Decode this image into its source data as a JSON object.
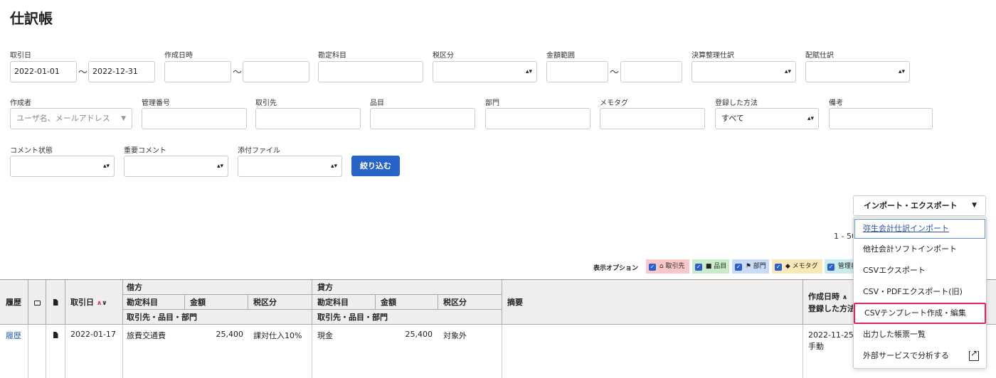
{
  "page": {
    "title": "仕訳帳"
  },
  "filters": {
    "trade_date": {
      "label": "取引日",
      "from": "2022-01-01",
      "to": "2022-12-31",
      "separator": "〜"
    },
    "created_at": {
      "label": "作成日時",
      "separator": "〜"
    },
    "account": {
      "label": "勘定科目"
    },
    "tax": {
      "label": "税区分"
    },
    "amount": {
      "label": "金額範囲",
      "separator": "〜"
    },
    "closing": {
      "label": "決算整理仕訳"
    },
    "allocation": {
      "label": "配賦仕訳"
    },
    "creator": {
      "label": "作成者",
      "placeholder": "ユーザ名、メールアドレス"
    },
    "manage_no": {
      "label": "管理番号"
    },
    "partner": {
      "label": "取引先"
    },
    "item": {
      "label": "品目"
    },
    "dept": {
      "label": "部門"
    },
    "memo_tag": {
      "label": "メモタグ"
    },
    "reg_method": {
      "label": "登録した方法",
      "value": "すべて"
    },
    "note": {
      "label": "備考"
    },
    "comment_status": {
      "label": "コメント状態"
    },
    "important_comment": {
      "label": "重要コメント"
    },
    "attachment": {
      "label": "添付ファイル"
    },
    "submit": "絞り込む"
  },
  "toolbar": {
    "import_export": "インポート・エクスポート",
    "range": "1 - 50",
    "display_options_label": "表示オプション",
    "chips": [
      {
        "label": "取引先",
        "color": "#f8c8c8"
      },
      {
        "label": "品目",
        "color": "#c8ecc8"
      },
      {
        "label": "部門",
        "color": "#c8dcf8"
      },
      {
        "label": "メモタグ",
        "color": "#f8e8b8"
      },
      {
        "label": "管理番号",
        "color": "#c8ecec"
      }
    ]
  },
  "menu": {
    "items": [
      "弥生会計仕訳インポート",
      "他社会計ソフトインポート",
      "CSVエクスポート",
      "CSV・PDFエクスポート(旧)",
      "CSVテンプレート作成・編集",
      "出力した帳票一覧",
      "外部サービスで分析する"
    ]
  },
  "table": {
    "headers": {
      "history": "履歴",
      "trade_date": "取引日",
      "debit": "借方",
      "credit": "貸方",
      "account": "勘定科目",
      "amount": "金額",
      "tax": "税区分",
      "partner_sub": "取引先・品目・部門",
      "summary": "摘要",
      "created": "作成日時",
      "reg_method": "登録した方法"
    },
    "rows": [
      {
        "history": "履歴",
        "date": "2022-01-17",
        "debit_account": "旅費交通費",
        "debit_amount": "25,400",
        "debit_tax": "課対仕入10%",
        "credit_account": "現金",
        "credit_amount": "25,400",
        "credit_tax": "対象外",
        "created": "2022-11-25 1",
        "method": "手動"
      }
    ]
  }
}
